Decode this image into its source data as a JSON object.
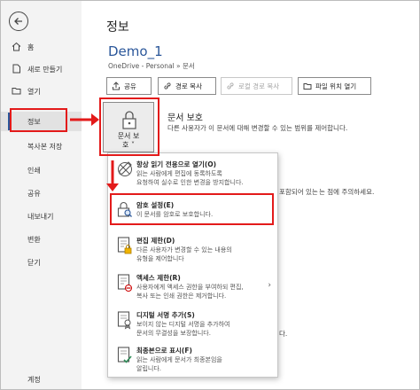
{
  "page_title": "정보",
  "sidebar": {
    "items": [
      {
        "label": "홈"
      },
      {
        "label": "새로 만들기"
      },
      {
        "label": "열기"
      },
      {
        "label": "정보"
      },
      {
        "label": "복사본 저장"
      },
      {
        "label": "인쇄"
      },
      {
        "label": "공유"
      },
      {
        "label": "내보내기"
      },
      {
        "label": "변환"
      },
      {
        "label": "닫기"
      },
      {
        "label": "계정"
      }
    ]
  },
  "document": {
    "title": "Demo_1",
    "path": "OneDrive - Personal » 문서"
  },
  "toolbar": {
    "share": "공유",
    "copy_path": "경로 복사",
    "copy_local_path": "로컬 경로 복사",
    "open_file_location": "파일 위치 열기"
  },
  "protect": {
    "button_line1": "문서 보",
    "button_line2": "호 ˅",
    "heading": "문서 보호",
    "description": "다른 사용자가 이 문서에 대해 변경할 수 있는 범위를 제어합니다."
  },
  "side_texts": {
    "line1": "포함되어 있는",
    "line2": "는 점에 주의하세요.",
    "line3": "다."
  },
  "menu": {
    "items": [
      {
        "title": "항상 읽기 전용으로 열기(O)",
        "desc": [
          "읽는 사람에게 편집에 동록하도록",
          "요청하여 실수로 인한 변경을 방지합니다."
        ]
      },
      {
        "title": "암호 설정(E)",
        "desc": [
          "이 문서를 암호로 보호합니다."
        ]
      },
      {
        "title": "편집 제한(D)",
        "desc": [
          "다른 사용자가 변경할 수 있는 내용의",
          "유형을 제어합니다"
        ]
      },
      {
        "title": "액세스 제한(R)",
        "desc": [
          "사용자에게 액세스 권한을 부여하되 편집,",
          "복사 또는 인쇄 권한은 제거합니다."
        ]
      },
      {
        "title": "디지털 서명 추가(S)",
        "desc": [
          "보이지 않는 디지털 서명을 추가하여",
          "문서의 무결성을 보장합니다."
        ]
      },
      {
        "title": "최종본으로 표시(F)",
        "desc": [
          "읽는 사람에게 문서가 최종본임을",
          "알립니다."
        ]
      }
    ]
  },
  "colors": {
    "accent": "#2b579a",
    "annotation": "#e31a1a",
    "sidebar_bg": "#f3f3f3"
  }
}
